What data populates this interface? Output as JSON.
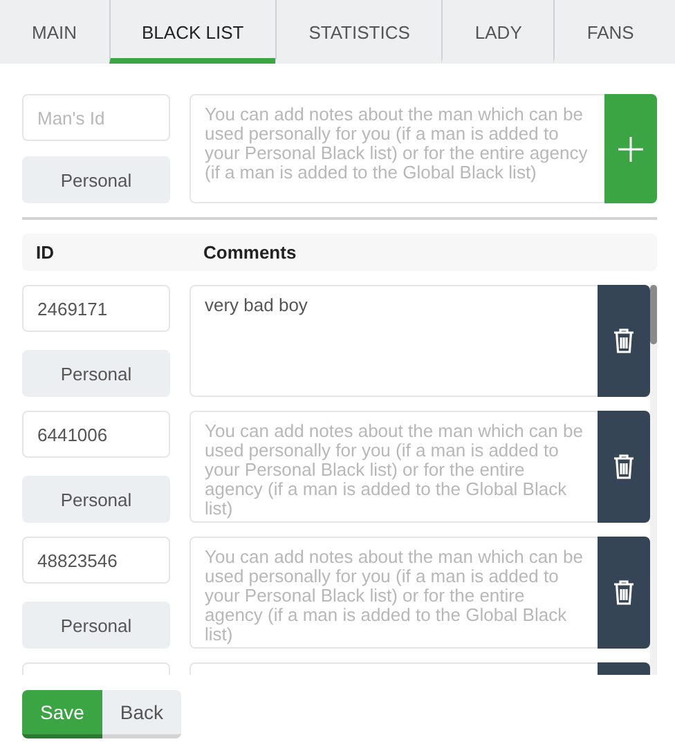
{
  "tabs": [
    {
      "label": "MAIN",
      "selected": false
    },
    {
      "label": "BLACK LIST",
      "selected": true
    },
    {
      "label": "STATISTICS",
      "selected": false
    },
    {
      "label": "LADY",
      "selected": false
    },
    {
      "label": "FANS",
      "selected": false
    }
  ],
  "add_form": {
    "id_placeholder": "Man's Id",
    "scope": "Personal",
    "comment_placeholder": "You can add notes about the man which can be used personally for you (if a man is added to your Personal Black list) or for the entire agency (if a man is added to the Global Black list)"
  },
  "columns": [
    "ID",
    "Comments"
  ],
  "rows": [
    {
      "id": "2469171",
      "scope": "Personal",
      "comment": "very bad boy"
    },
    {
      "id": "6441006",
      "scope": "Personal",
      "comment_placeholder": "You can add notes about the man which can be used personally for you (if a man is added to your Personal Black list) or for the entire agency (if a man is added to the Global Black list)"
    },
    {
      "id": "48823546",
      "scope": "Personal",
      "comment_placeholder": "You can add notes about the man which can be used personally for you (if a man is added to your Personal Black list) or for the entire agency (if a man is added to the Global Black list)"
    },
    {}
  ],
  "buttons": {
    "save": "Save",
    "back": "Back"
  }
}
